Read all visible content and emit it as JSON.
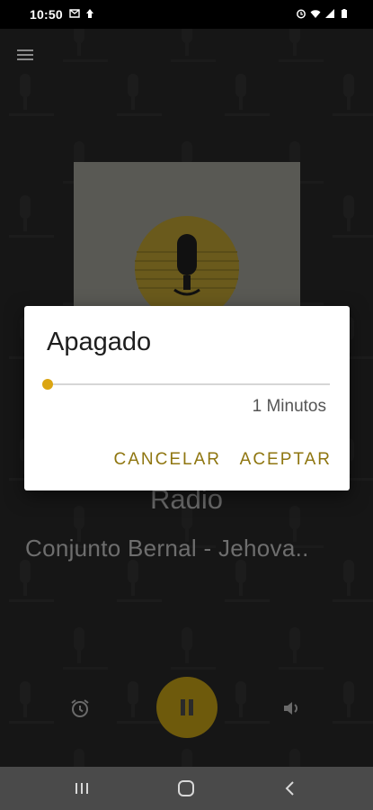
{
  "status_bar": {
    "time": "10:50",
    "left_icons": [
      "gmail-icon",
      "notification-icon"
    ],
    "right_icons": [
      "alarm-icon",
      "wifi-icon",
      "signal-icon",
      "battery-icon"
    ]
  },
  "app": {
    "menu_icon": "hamburger-menu-icon",
    "station_name": "Radio",
    "now_playing": "Conjunto Bernal - Jehova..",
    "controls": {
      "alarm_icon": "alarm-clock-icon",
      "play_state_icon": "pause-icon",
      "volume_icon": "volume-icon"
    },
    "colors": {
      "accent": "#dba512",
      "dialog_button": "#8f7610"
    }
  },
  "dialog": {
    "title": "Apagado",
    "slider_fraction": 0.0,
    "value_label": "1 Minutos",
    "cancel_label": "CANCELAR",
    "accept_label": "ACEPTAR"
  },
  "nav_bar": {
    "recents_icon": "recents-icon",
    "home_icon": "home-icon",
    "back_icon": "back-icon"
  }
}
